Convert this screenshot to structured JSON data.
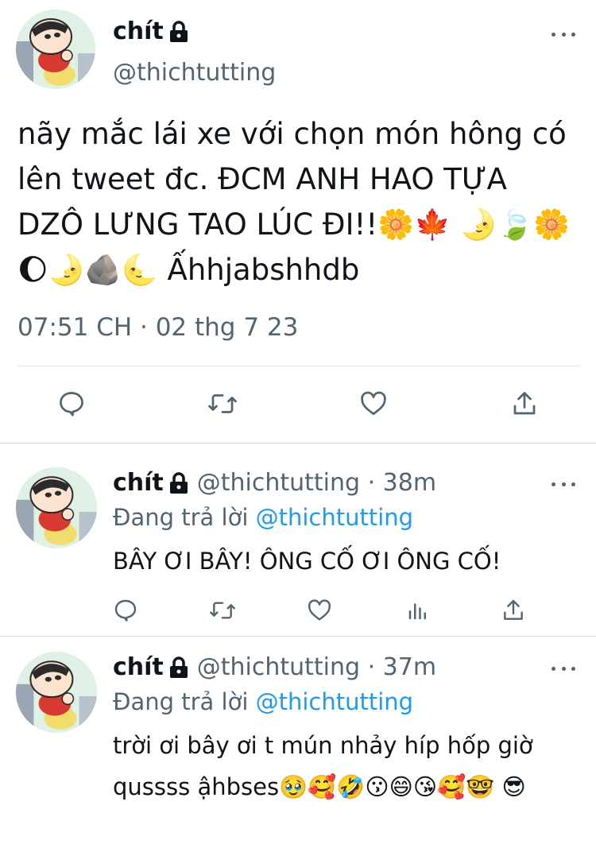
{
  "main_tweet": {
    "display_name": "chít",
    "handle": "@thichtutting",
    "text": "nãy mắc lái xe với chọn món hông có lên tweet đc. ĐCM ANH HAO TỰA DZÔ LƯNG TAO LÚC ĐI!!🌼🍁 🌛🍃🌼🌔🌛🪨🌜 Ấhhjabshhdb",
    "timestamp": "07:51 CH · 02 thg 7 23",
    "icons": [
      "reply-icon",
      "retweet-icon",
      "like-icon",
      "share-icon"
    ]
  },
  "replies": [
    {
      "display_name": "chít",
      "meta": "@thichtutting · 38m",
      "replying_prefix": "Đang trả lời",
      "replying_to": "@thichtutting",
      "text": "BÂY ƠI BÂY! ÔNG CỐ ƠI ÔNG CỐ!",
      "icons": [
        "reply-icon",
        "retweet-icon",
        "like-icon",
        "analytics-icon",
        "share-icon"
      ]
    },
    {
      "display_name": "chít",
      "meta": "@thichtutting · 37m",
      "replying_prefix": "Đang trả lời",
      "replying_to": "@thichtutting",
      "text": "trời ơi bây ơi t mún nhảy híp hốp giờ qussss ậhbses🥹🥰🤣😗😄😘🥰🤓 😎"
    }
  ],
  "colors": {
    "text": "#0f1419",
    "secondary": "#536471",
    "accent": "#1d9bf0",
    "divider": "#e1e6ea"
  }
}
